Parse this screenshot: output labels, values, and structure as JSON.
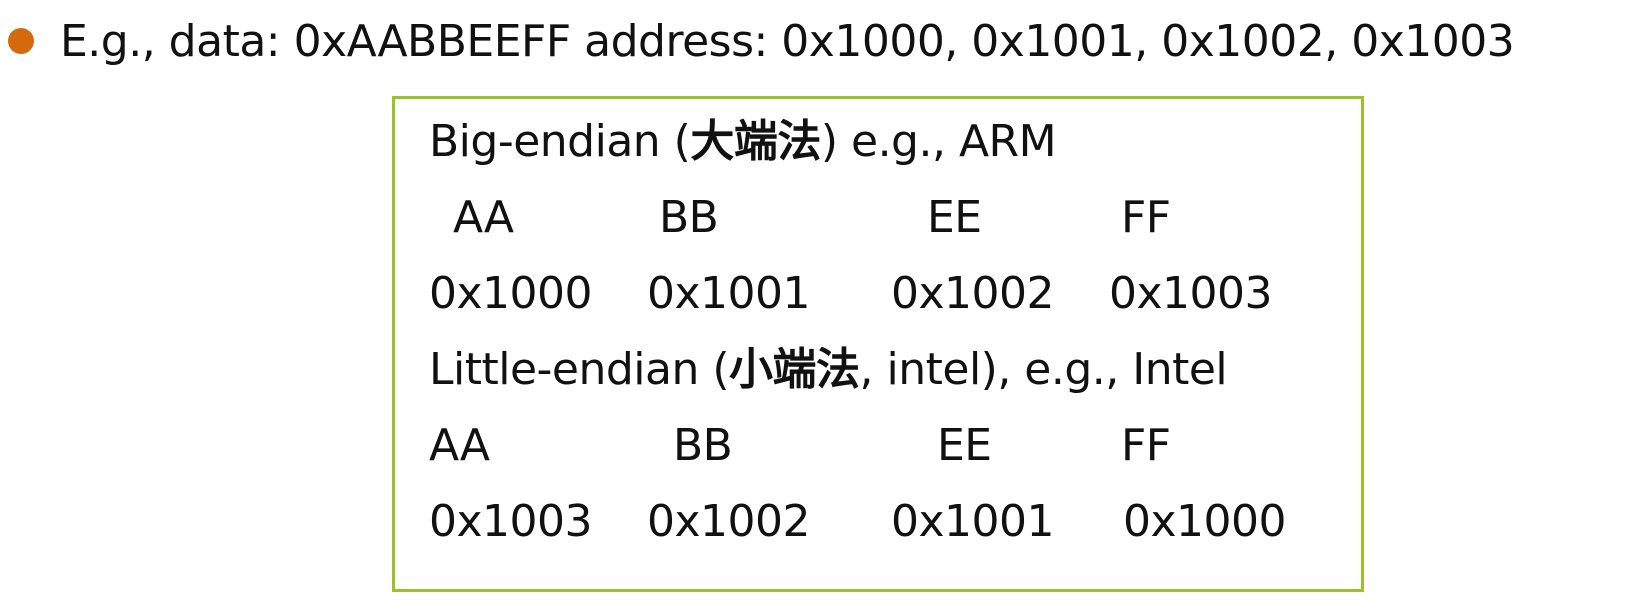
{
  "bullet": {
    "text": "E.g., data: 0xAABBEEFF address: 0x1000, 0x1001, 0x1002, 0x1003",
    "dot_color": "#d46a0c"
  },
  "box": {
    "border_color": "#9ac22c",
    "big_endian": {
      "title_prefix": "Big-endian (",
      "title_cjk": "大端法",
      "title_suffix": ") e.g., ARM",
      "bytes": [
        "AA",
        "BB",
        "EE",
        "FF"
      ],
      "addresses": [
        "0x1000",
        "0x1001",
        "0x1002",
        "0x1003"
      ]
    },
    "little_endian": {
      "title_prefix": "Little-endian (",
      "title_cjk": "小端法",
      "title_suffix": ", intel), e.g., Intel",
      "bytes": [
        "AA",
        "BB",
        "EE",
        "FF"
      ],
      "addresses": [
        "0x1003",
        "0x1002",
        "0x1001",
        "0x1000"
      ]
    }
  }
}
